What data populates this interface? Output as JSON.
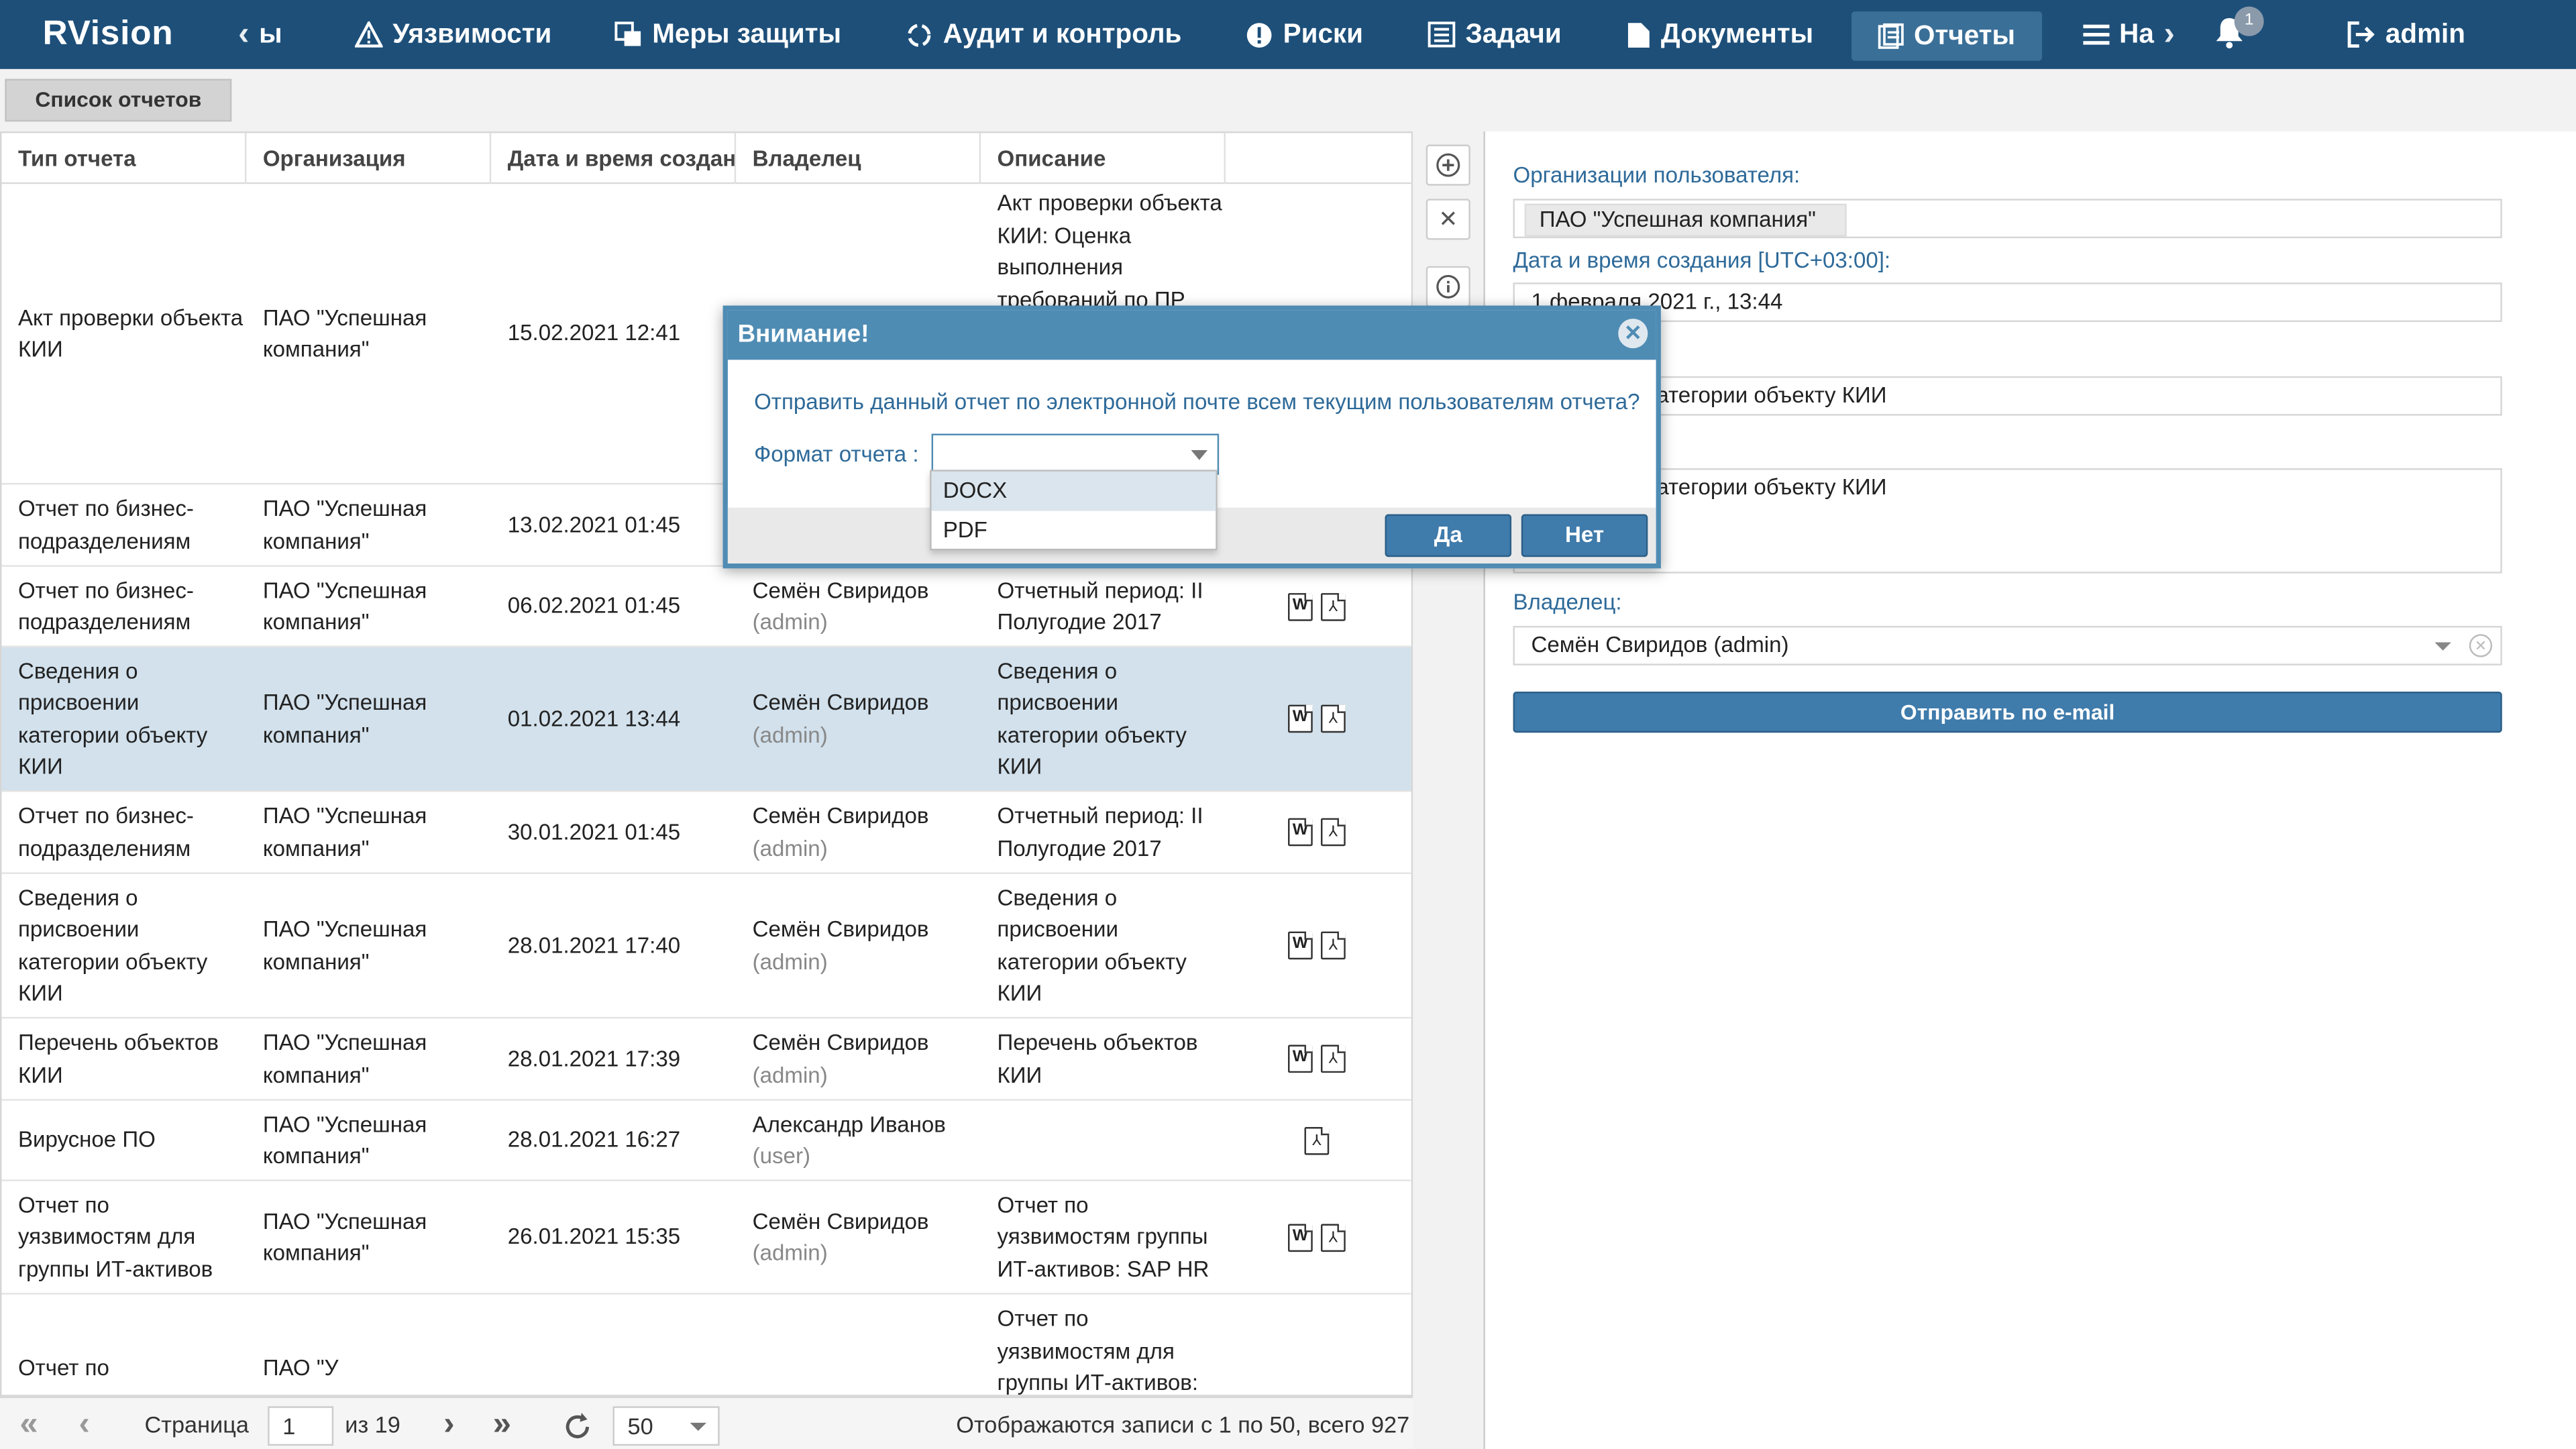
{
  "app": {
    "logo": "RVision"
  },
  "nav": {
    "prev_label": "ы",
    "items": [
      {
        "label": "Уязвимости",
        "icon": "warning-icon"
      },
      {
        "label": "Меры защиты",
        "icon": "shield-grid-icon"
      },
      {
        "label": "Аудит и контроль",
        "icon": "refresh-cycle-icon"
      },
      {
        "label": "Риски",
        "icon": "exclamation-circle-icon"
      },
      {
        "label": "Задачи",
        "icon": "task-list-icon"
      },
      {
        "label": "Документы",
        "icon": "documents-icon"
      },
      {
        "label": "Отчеты",
        "icon": "reports-icon",
        "active": true
      },
      {
        "label": "На",
        "icon": "menu-icon"
      }
    ],
    "notifications_count": "1",
    "user": "admin"
  },
  "tab": {
    "label": "Список отчетов"
  },
  "grid": {
    "columns": [
      "Тип отчета",
      "Организация",
      "Дата и время создан",
      "Владелец",
      "Описание",
      ""
    ],
    "rows": [
      {
        "type": "Акт проверки объекта КИИ",
        "org": "ПАО \"Успешная компания\"",
        "date": "15.02.2021 12:41",
        "owner": "",
        "owner_sub": "",
        "desc": "Акт проверки объекта КИИ: Оценка выполнения требований по ПР",
        "files": [
          "docx",
          "pdf"
        ]
      },
      {
        "type": "Отчет по бизнес-подразделениям",
        "org": "ПАО \"Успешная компания\"",
        "date": "13.02.2021 01:45",
        "owner": "",
        "owner_sub": "",
        "desc": "",
        "files": []
      },
      {
        "type": "Отчет по бизнес-подразделениям",
        "org": "ПАО \"Успешная компания\"",
        "date": "06.02.2021 01:45",
        "owner": "Семён Свиридов",
        "owner_sub": "(admin)",
        "desc": "Отчетный период: II Полугодие 2017",
        "files": [
          "docx",
          "pdf"
        ]
      },
      {
        "type": "Сведения о присвоении категории объекту КИИ",
        "org": "ПАО \"Успешная компания\"",
        "date": "01.02.2021 13:44",
        "owner": "Семён Свиридов",
        "owner_sub": "(admin)",
        "desc": "Сведения о присвоении категории объекту КИИ",
        "files": [
          "docx",
          "pdf"
        ],
        "selected": true
      },
      {
        "type": "Отчет по бизнес-подразделениям",
        "org": "ПАО \"Успешная компания\"",
        "date": "30.01.2021 01:45",
        "owner": "Семён Свиридов",
        "owner_sub": "(admin)",
        "desc": "Отчетный период: II Полугодие 2017",
        "files": [
          "docx",
          "pdf"
        ]
      },
      {
        "type": "Сведения о присвоении категории объекту КИИ",
        "org": "ПАО \"Успешная компания\"",
        "date": "28.01.2021 17:40",
        "owner": "Семён Свиридов",
        "owner_sub": "(admin)",
        "desc": "Сведения о присвоении категории объекту КИИ",
        "files": [
          "docx",
          "pdf"
        ]
      },
      {
        "type": "Перечень объектов КИИ",
        "org": "ПАО \"Успешная компания\"",
        "date": "28.01.2021 17:39",
        "owner": "Семён Свиридов",
        "owner_sub": "(admin)",
        "desc": "Перечень объектов КИИ",
        "files": [
          "docx",
          "pdf"
        ]
      },
      {
        "type": "Вирусное ПО",
        "org": "ПАО \"Успешная компания\"",
        "date": "28.01.2021 16:27",
        "owner": "Александр Иванов",
        "owner_sub": "(user)",
        "desc": "",
        "files": [
          "pdf"
        ]
      },
      {
        "type": "Отчет по уязвимостям для группы ИТ-активов",
        "org": "ПАО \"Успешная компания\"",
        "date": "26.01.2021 15:35",
        "owner": "Семён Свиридов",
        "owner_sub": "(admin)",
        "desc": "Отчет по уязвимостям группы ИТ-активов: SAP HR",
        "files": [
          "docx",
          "pdf"
        ]
      },
      {
        "type": "Отчет по",
        "org": "ПАО \"У",
        "date": "",
        "owner": "",
        "owner_sub": "",
        "desc": "Отчет по уязвимостям для группы ИТ-активов:",
        "files": []
      }
    ]
  },
  "pager": {
    "page_label": "Страница",
    "page": "1",
    "of_label": "из 19",
    "page_size": "50",
    "summary": "Отображаются записи с 1 по 50, всего 927"
  },
  "detail": {
    "org_label": "Организации пользователя:",
    "org_value": "ПАО \"Успешная компания\"",
    "date_label": "Дата и время создания [UTC+03:00]:",
    "date_value": "1 февраля 2021 г., 13:44",
    "name_value": "рисвоении категории объекту КИИ",
    "desc_value": "рисвоении категории объекту КИИ",
    "owner_label": "Владелец:",
    "owner_value": "Семён Свиридов (admin)",
    "send_label": "Отправить по e-mail"
  },
  "modal": {
    "title": "Внимание!",
    "question": "Отправить данный отчет по электронной почте всем текущим пользователям отчета?",
    "format_label": "Формат отчета :",
    "options": [
      "DOCX",
      "PDF"
    ],
    "yes": "Да",
    "no": "Нет"
  }
}
